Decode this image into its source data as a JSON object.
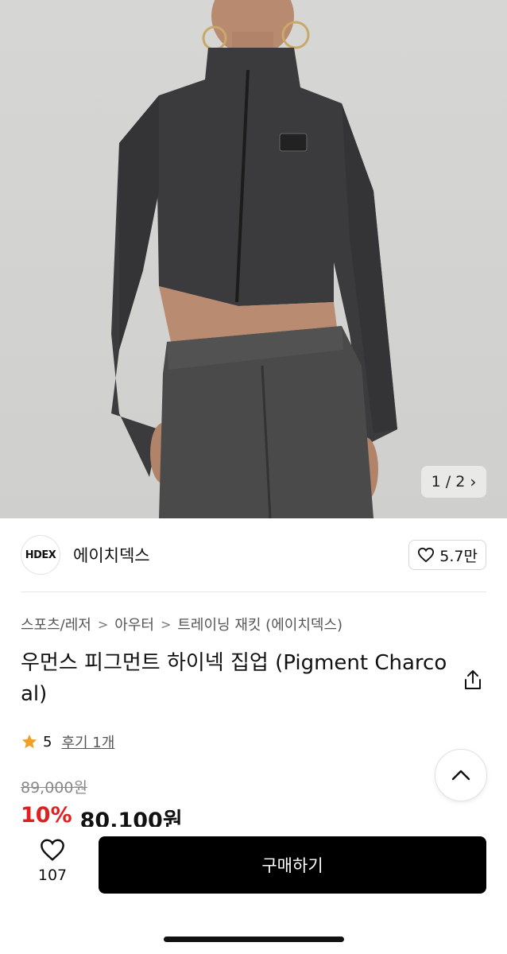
{
  "gallery": {
    "page_indicator": "1 / 2",
    "next_icon": "chevron-right-icon"
  },
  "brand": {
    "logo_text": "HDEX",
    "name": "에이치덱스",
    "likes": "5.7만"
  },
  "breadcrumb": {
    "items": [
      "스포츠/레저",
      "아우터",
      "트레이닝 재킷 (에이치덱스)"
    ],
    "separator": ">"
  },
  "product": {
    "title": "우먼스 피그먼트 하이넥 집업 (Pigment Charcoal)",
    "rating": "5",
    "review_link": "후기 1개",
    "original_price": "89,000원",
    "discount": "10%",
    "sale_price": "80,100원"
  },
  "bottom_bar": {
    "wish_count": "107",
    "buy_label": "구매하기"
  },
  "colors": {
    "discount_red": "#e0201f",
    "buy_button_bg": "#000000",
    "star": "#f0a028"
  }
}
